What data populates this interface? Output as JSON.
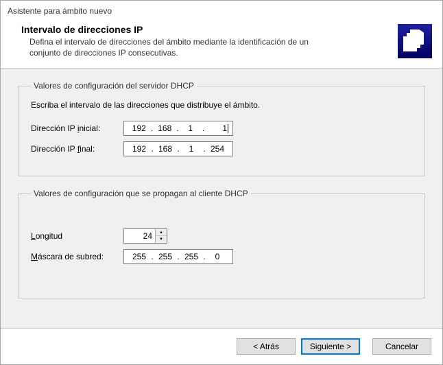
{
  "window": {
    "title": "Asistente para ámbito nuevo"
  },
  "header": {
    "title": "Intervalo de direcciones IP",
    "description": "Defina el intervalo de direcciones del ámbito mediante la identificación de un conjunto de direcciones IP consecutivas."
  },
  "group_server": {
    "legend": "Valores de configuración del servidor DHCP",
    "intro": "Escriba el intervalo de las direcciones que distribuye el ámbito.",
    "start_label_prefix": "Dirección IP ",
    "start_label_u": "i",
    "start_label_suffix": "nicial:",
    "start_ip": {
      "o1": "192",
      "o2": "168",
      "o3": "1",
      "o4": "1"
    },
    "end_label_prefix": "Dirección IP ",
    "end_label_u": "f",
    "end_label_suffix": "inal:",
    "end_ip": {
      "o1": "192",
      "o2": "168",
      "o3": "1",
      "o4": "254"
    }
  },
  "group_client": {
    "legend": "Valores de configuración que se propagan al cliente DHCP",
    "length_u": "L",
    "length_suffix": "ongitud",
    "length_value": "24",
    "mask_u": "M",
    "mask_suffix": "áscara de subred:",
    "mask_ip": {
      "o1": "255",
      "o2": "255",
      "o3": "255",
      "o4": "0"
    }
  },
  "buttons": {
    "back": "< Atrás",
    "next": "Siguiente >",
    "cancel": "Cancelar"
  }
}
